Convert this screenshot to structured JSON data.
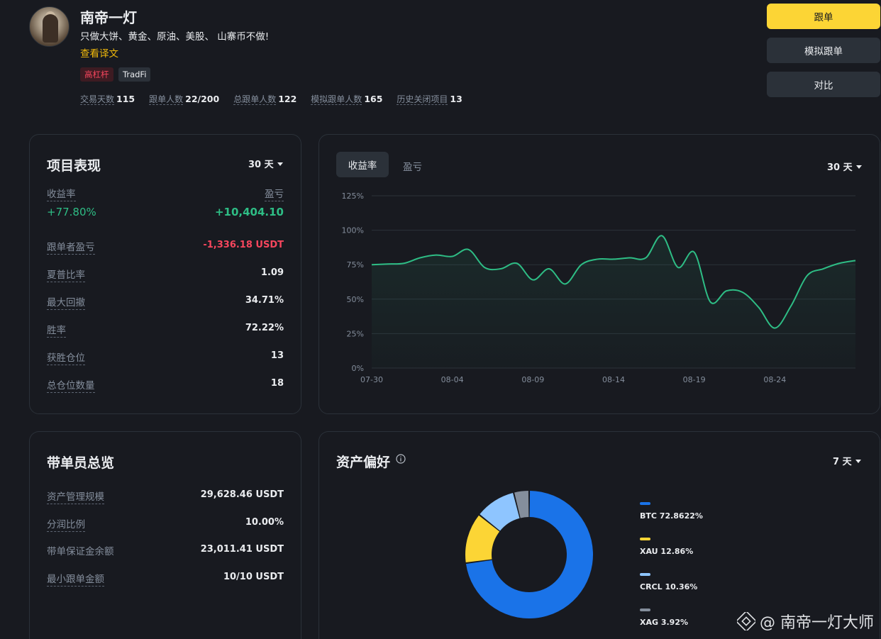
{
  "profile": {
    "name": "南帝一灯",
    "bio": "只做大饼、黄金、原油、美股、 山寨币不做!",
    "translate_link": "查看译文",
    "tags": [
      "高杠杆",
      "TradFi"
    ],
    "stats": [
      {
        "label": "交易天数",
        "value": "115"
      },
      {
        "label": "跟单人数",
        "value": "22/200"
      },
      {
        "label": "总跟单人数",
        "value": "122"
      },
      {
        "label": "模拟跟单人数",
        "value": "165"
      },
      {
        "label": "历史关闭项目",
        "value": "13"
      }
    ]
  },
  "actions": {
    "copy": "跟单",
    "mock_copy": "模拟跟单",
    "compare": "对比"
  },
  "performance": {
    "title": "项目表现",
    "period": "30 天",
    "roi_label": "收益率",
    "pnl_label": "盈亏",
    "roi_value": "+77.80%",
    "pnl_value": "+10,404.10",
    "rows": [
      {
        "label": "跟单者盈亏",
        "value": "-1,336.18 USDT"
      },
      {
        "label": "夏普比率",
        "value": "1.09"
      },
      {
        "label": "最大回撤",
        "value": "34.71%"
      },
      {
        "label": "胜率",
        "value": "72.22%"
      },
      {
        "label": "获胜仓位",
        "value": "13"
      },
      {
        "label": "总仓位数量",
        "value": "18"
      }
    ]
  },
  "chart_panel": {
    "tab_active": "收益率",
    "tab_inactive": "盈亏",
    "period": "30 天"
  },
  "chart_data": {
    "type": "area",
    "y_ticks": [
      "125%",
      "100%",
      "75%",
      "50%",
      "25%",
      "0%"
    ],
    "x_ticks": [
      "07-30",
      "08-04",
      "08-09",
      "08-14",
      "08-19",
      "08-24"
    ],
    "ylim": [
      0,
      125
    ],
    "line_color": "#2ebd85",
    "x": [
      "07-30",
      "07-31",
      "08-01",
      "08-02",
      "08-03",
      "08-04",
      "08-05",
      "08-06",
      "08-07",
      "08-08",
      "08-09",
      "08-10",
      "08-11",
      "08-12",
      "08-13",
      "08-14",
      "08-15",
      "08-16",
      "08-17",
      "08-18",
      "08-19",
      "08-20",
      "08-21",
      "08-22",
      "08-23",
      "08-24",
      "08-25",
      "08-26",
      "08-27",
      "08-28",
      "08-29"
    ],
    "series": [
      {
        "values": [
          75,
          75.5,
          76,
          80,
          82,
          81,
          86,
          73,
          72,
          76,
          64,
          72,
          61,
          75,
          79,
          79,
          80,
          80,
          96,
          73,
          84,
          48,
          56,
          55,
          44,
          29,
          45,
          67,
          72,
          76,
          78
        ]
      }
    ]
  },
  "leader": {
    "title": "带单员总览",
    "rows": [
      {
        "label": "资产管理规模",
        "value": "29,628.46 USDT"
      },
      {
        "label": "分润比例",
        "value": "10.00%"
      },
      {
        "label": "带单保证金余额",
        "value": "23,011.41 USDT"
      },
      {
        "label": "最小跟单金额",
        "value": "10/10 USDT"
      }
    ]
  },
  "assets": {
    "title": "资产偏好",
    "period": "7 天",
    "items": [
      {
        "label": "BTC 72.8622%",
        "value": 72.8622,
        "color": "#1a73e8"
      },
      {
        "label": "XAU 12.86%",
        "value": 12.86,
        "color": "#fcd535"
      },
      {
        "label": "CRCL 10.36%",
        "value": 10.36,
        "color": "#8ec5ff"
      },
      {
        "label": "XAG 3.92%",
        "value": 3.92,
        "color": "#848e9c"
      }
    ]
  },
  "watermark": "@ 南帝一灯大师"
}
